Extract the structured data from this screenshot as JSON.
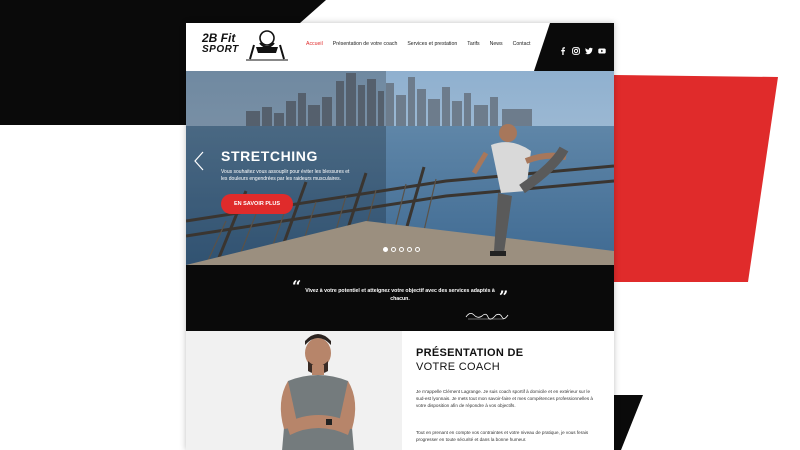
{
  "logo": {
    "line1": "2B Fit",
    "line2": "SPORT"
  },
  "nav": {
    "items": [
      {
        "label": "Accueil",
        "active": true
      },
      {
        "label": "Présentation de votre coach",
        "active": false
      },
      {
        "label": "Services et prestation",
        "active": false
      },
      {
        "label": "Tarifs",
        "active": false
      },
      {
        "label": "News",
        "active": false
      },
      {
        "label": "Contact",
        "active": false
      }
    ]
  },
  "social": [
    "facebook-icon",
    "instagram-icon",
    "twitter-icon",
    "youtube-icon"
  ],
  "hero": {
    "title": "STRETCHING",
    "subtitle": "Vous souhaitez vous assouplir pour éviter les blessures et les douleurs engendrées par les raideurs musculaires.",
    "button": "EN SAVOIR PLUS",
    "slides": 5,
    "active_slide": 1
  },
  "quote": {
    "text": "Vivez à votre potentiel et atteignez votre objectif avec des services adaptés à chacun.",
    "open_mark": "“",
    "close_mark": "”"
  },
  "presentation": {
    "title_line1": "PRÉSENTATION DE",
    "title_line2": "VOTRE COACH",
    "para1": "Je m'appelle Clément Lagrange. Je suis coach sportif à domicile et en extérieur sur le sud-est lyonnais. Je mets tout mon savoir-faire et mes compétences professionnelles à votre disposition afin de répondre à vos objectifs.",
    "para2": "Tout en prenant en compte vos contraintes et votre niveau de pratique, je vous ferais progresser en toute sécurité et dans la bonne humeur."
  },
  "colors": {
    "accent": "#e02b2b",
    "dark": "#0a0a0a"
  }
}
